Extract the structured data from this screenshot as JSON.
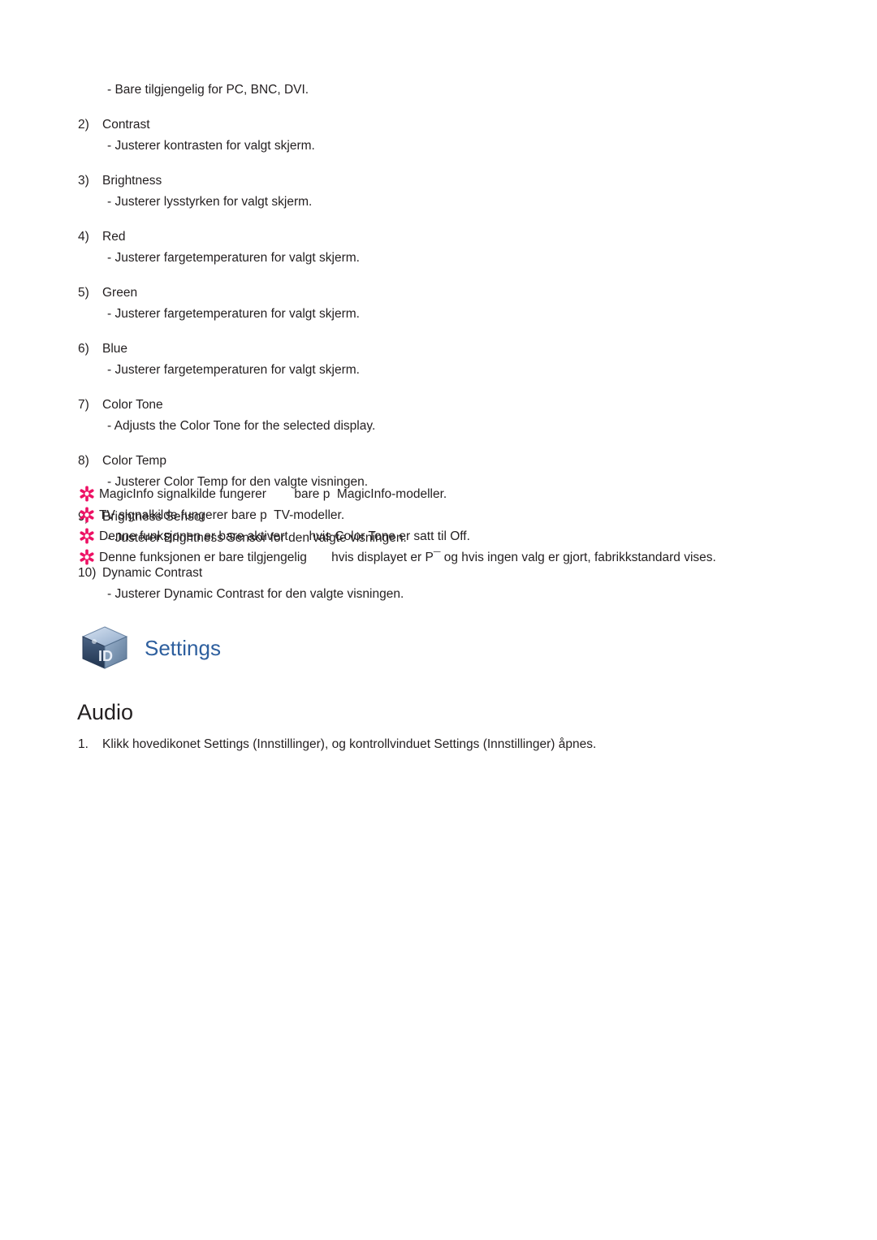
{
  "document": {
    "intro_note": "- Bare tilgjengelig for PC, BNC, DVI.",
    "items": [
      {
        "index": "2)",
        "label": "Contrast",
        "desc": "- Justerer kontrasten for valgt skjerm."
      },
      {
        "index": "3)",
        "label": "Brightness",
        "desc": "- Justerer lysstyrken for valgt skjerm."
      },
      {
        "index": "4)",
        "label": "Red",
        "desc": "- Justerer fargetemperaturen for valgt skjerm."
      },
      {
        "index": "5)",
        "label": "Green",
        "desc": "- Justerer fargetemperaturen for valgt skjerm."
      },
      {
        "index": "6)",
        "label": "Blue",
        "desc": "- Justerer fargetemperaturen for valgt skjerm."
      },
      {
        "index": "7)",
        "label": "Color Tone",
        "desc": "- Adjusts the Color Tone for the selected display."
      },
      {
        "index": "8)",
        "label": "Color Temp",
        "desc": "- Justerer Color Temp for den valgte visningen."
      },
      {
        "index": "9)",
        "label": "Brightness Sensor",
        "desc": "- Justerer Brightness Sensor for den valgte visningen."
      },
      {
        "index": "10)",
        "label": "Dynamic Contrast",
        "desc": "- Justerer Dynamic Contrast for den valgte visningen."
      }
    ],
    "notes": [
      "MagicInfo signalkilde fungerer        bare p  MagicInfo-modeller.",
      "TV signalkilde fungerer bare p  TV-modeller.",
      "Denne funksjonen er bare aktivert      hvis Color Tone er satt til Off.",
      "Denne funksjonen er bare tilgjengelig       hvis displayet er P¯ og hvis ingen valg er gjort, fabrikkstandard vises."
    ],
    "section": {
      "icon_label": "settings-cube-icon",
      "title": "Settings",
      "subtitle": "Audio",
      "step_index": "1.",
      "step_text": "Klikk hovedikonet Settings (Innstillinger), og kontrollvinduet Settings (Innstillinger) åpnes."
    },
    "colors": {
      "star": "#ed1164",
      "heading": "#2e5f9e",
      "text": "#231f20"
    }
  }
}
